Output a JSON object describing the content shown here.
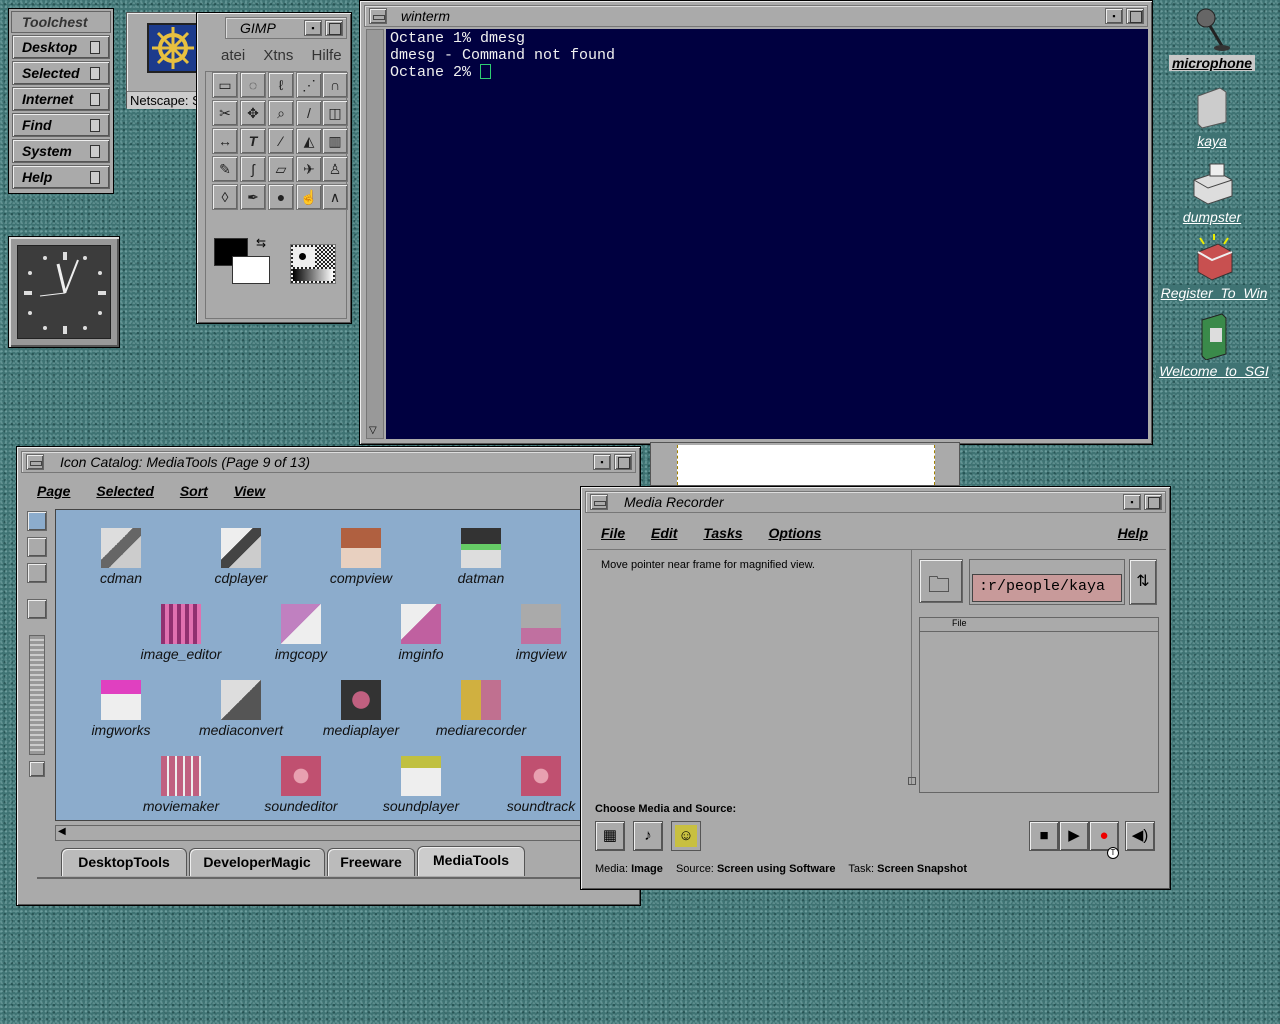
{
  "toolchest": {
    "title": "Toolchest",
    "items": [
      {
        "label": "Desktop"
      },
      {
        "label": "Selected"
      },
      {
        "label": "Internet"
      },
      {
        "label": "Find"
      },
      {
        "label": "System"
      },
      {
        "label": "Help"
      }
    ]
  },
  "netscape": {
    "label": "Netscape: SGI"
  },
  "gimp": {
    "title": "GIMP",
    "menu": [
      "atei",
      "Xtns",
      "Hilfe"
    ]
  },
  "winterm": {
    "title": "winterm",
    "lines": [
      "Octane 1% dmesg",
      "dmesg - Command not found",
      "Octane 2% "
    ]
  },
  "catalog": {
    "title": "Icon Catalog: MediaTools (Page 9 of 13)",
    "menu": [
      "Page",
      "Selected",
      "Sort",
      "View"
    ],
    "icons": [
      {
        "label": "cdman"
      },
      {
        "label": "cdplayer"
      },
      {
        "label": "compview"
      },
      {
        "label": "datman"
      },
      {
        "label": "image_editor"
      },
      {
        "label": "imgcopy"
      },
      {
        "label": "imginfo"
      },
      {
        "label": "imgview"
      },
      {
        "label": "imgworks"
      },
      {
        "label": "mediaconvert"
      },
      {
        "label": "mediaplayer"
      },
      {
        "label": "mediarecorder"
      },
      {
        "label": "moviemaker"
      },
      {
        "label": "soundeditor"
      },
      {
        "label": "soundplayer"
      },
      {
        "label": "soundtrack"
      }
    ],
    "tabs": [
      "DesktopTools",
      "DeveloperMagic",
      "Freeware",
      "MediaTools"
    ],
    "active_tab": "MediaTools"
  },
  "recorder": {
    "title": "Media Recorder",
    "menu": [
      "File",
      "Edit",
      "Tasks",
      "Options"
    ],
    "help": "Help",
    "hint": "Move pointer near frame for magnified view.",
    "path": ":r/people/kaya",
    "file_header": "File",
    "choose_label": "Choose Media and Source:",
    "status": {
      "media_label": "Media:",
      "media_value": "Image",
      "source_label": "Source:",
      "source_value": "Screen using Software",
      "task_label": "Task:",
      "task_value": "Screen Snapshot"
    }
  },
  "desktop_icons": [
    {
      "label": "microphone"
    },
    {
      "label": "kaya"
    },
    {
      "label": "dumpster"
    },
    {
      "label": "Register_To_Win"
    },
    {
      "label": "Welcome_to_SGI"
    }
  ],
  "colors": {
    "desktop": "#3f7373",
    "terminal_bg": "#000040",
    "catalog_bg": "#8caccc",
    "path_field": "#c89a9a"
  }
}
